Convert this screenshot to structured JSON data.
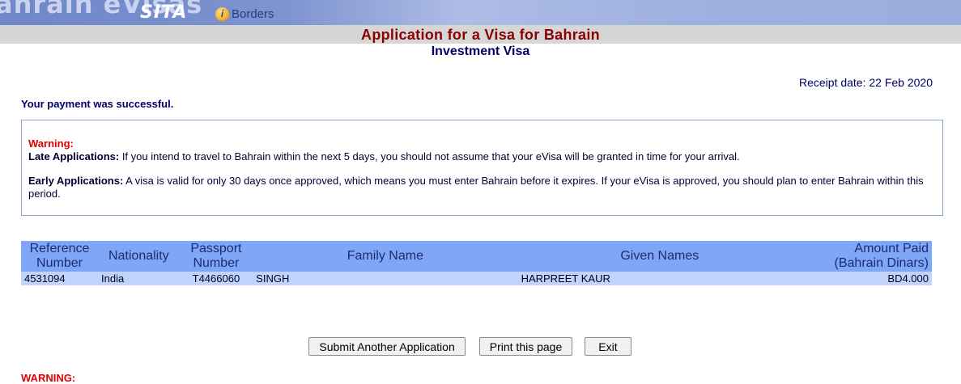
{
  "banner": {
    "brand_left": "ahrain eVisas",
    "brand_sita": "SITA",
    "brand_i": "i",
    "brand_borders": "Borders",
    "colors": {
      "banner_start": "#6f86c8",
      "banner_end": "#9aaede"
    }
  },
  "header": {
    "title": "Application for a Visa for Bahrain",
    "subtitle": "Investment Visa"
  },
  "receipt": {
    "date_label": "Receipt date: 22 Feb 2020"
  },
  "status": {
    "message": "Your payment was successful."
  },
  "warning": {
    "title": "Warning:",
    "late_label": "Late Applications:",
    "late_text": " If you intend to travel to Bahrain within the next 5 days, you should not assume that your eVisa will be granted in time for your arrival.",
    "early_label": "Early Applications:",
    "early_text": " A visa is valid for only 30 days once approved, which means you must enter Bahrain before it expires. If your eVisa is approved, you should plan to enter Bahrain within this period."
  },
  "table": {
    "headers": {
      "ref": "Reference Number",
      "nationality": "Nationality",
      "passport": "Passport Number",
      "family": "Family Name",
      "given": "Given Names",
      "amount": "Amount Paid (Bahrain Dinars)"
    },
    "rows": [
      {
        "ref": "4531094",
        "nationality": "India",
        "passport": "T4466060",
        "family": "SINGH",
        "given": "HARPREET KAUR",
        "amount": "BD4.000"
      }
    ]
  },
  "actions": {
    "submit_another": "Submit Another Application",
    "print": "Print this page",
    "exit": "Exit"
  },
  "footer": {
    "warning": "WARNING:"
  }
}
